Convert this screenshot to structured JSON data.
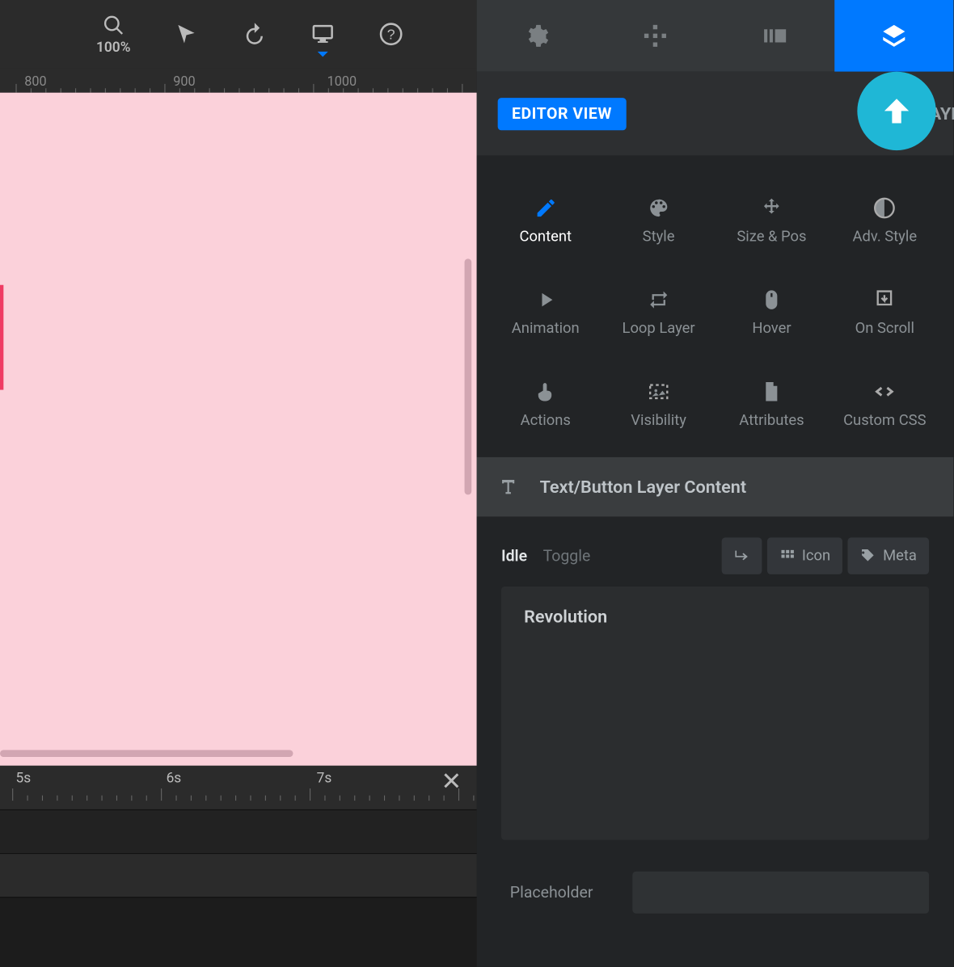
{
  "toolbar": {
    "zoom_label": "100%"
  },
  "ruler": {
    "marks": [
      "800",
      "900",
      "1000"
    ]
  },
  "topTabs": [
    {
      "name": "settings"
    },
    {
      "name": "navigation"
    },
    {
      "name": "slides"
    },
    {
      "name": "layers"
    }
  ],
  "sideHead": {
    "pill": "EDITOR VIEW",
    "title": "LAYER O"
  },
  "categories": [
    {
      "label": "Content",
      "icon": "pencil",
      "active": true
    },
    {
      "label": "Style",
      "icon": "palette",
      "active": false
    },
    {
      "label": "Size & Pos",
      "icon": "move",
      "active": false
    },
    {
      "label": "Adv. Style",
      "icon": "contrast",
      "active": false
    },
    {
      "label": "Animation",
      "icon": "play",
      "active": false
    },
    {
      "label": "Loop Layer",
      "icon": "loop",
      "active": false
    },
    {
      "label": "Hover",
      "icon": "mouse",
      "active": false
    },
    {
      "label": "On Scroll",
      "icon": "download",
      "active": false
    },
    {
      "label": "Actions",
      "icon": "touch",
      "active": false
    },
    {
      "label": "Visibility",
      "icon": "dashedimg",
      "active": false
    },
    {
      "label": "Attributes",
      "icon": "file",
      "active": false
    },
    {
      "label": "Custom CSS",
      "icon": "code",
      "active": false
    }
  ],
  "section": {
    "title": "Text/Button Layer Content"
  },
  "states": {
    "idle": "Idle",
    "toggle": "Toggle"
  },
  "chips": {
    "linebreak": "",
    "icon": "Icon",
    "meta": "Meta"
  },
  "editor": {
    "text": "Revolution"
  },
  "field": {
    "placeholder_label": "Placeholder",
    "value": ""
  },
  "timeline": {
    "marks": [
      "5s",
      "6s",
      "7s"
    ]
  }
}
